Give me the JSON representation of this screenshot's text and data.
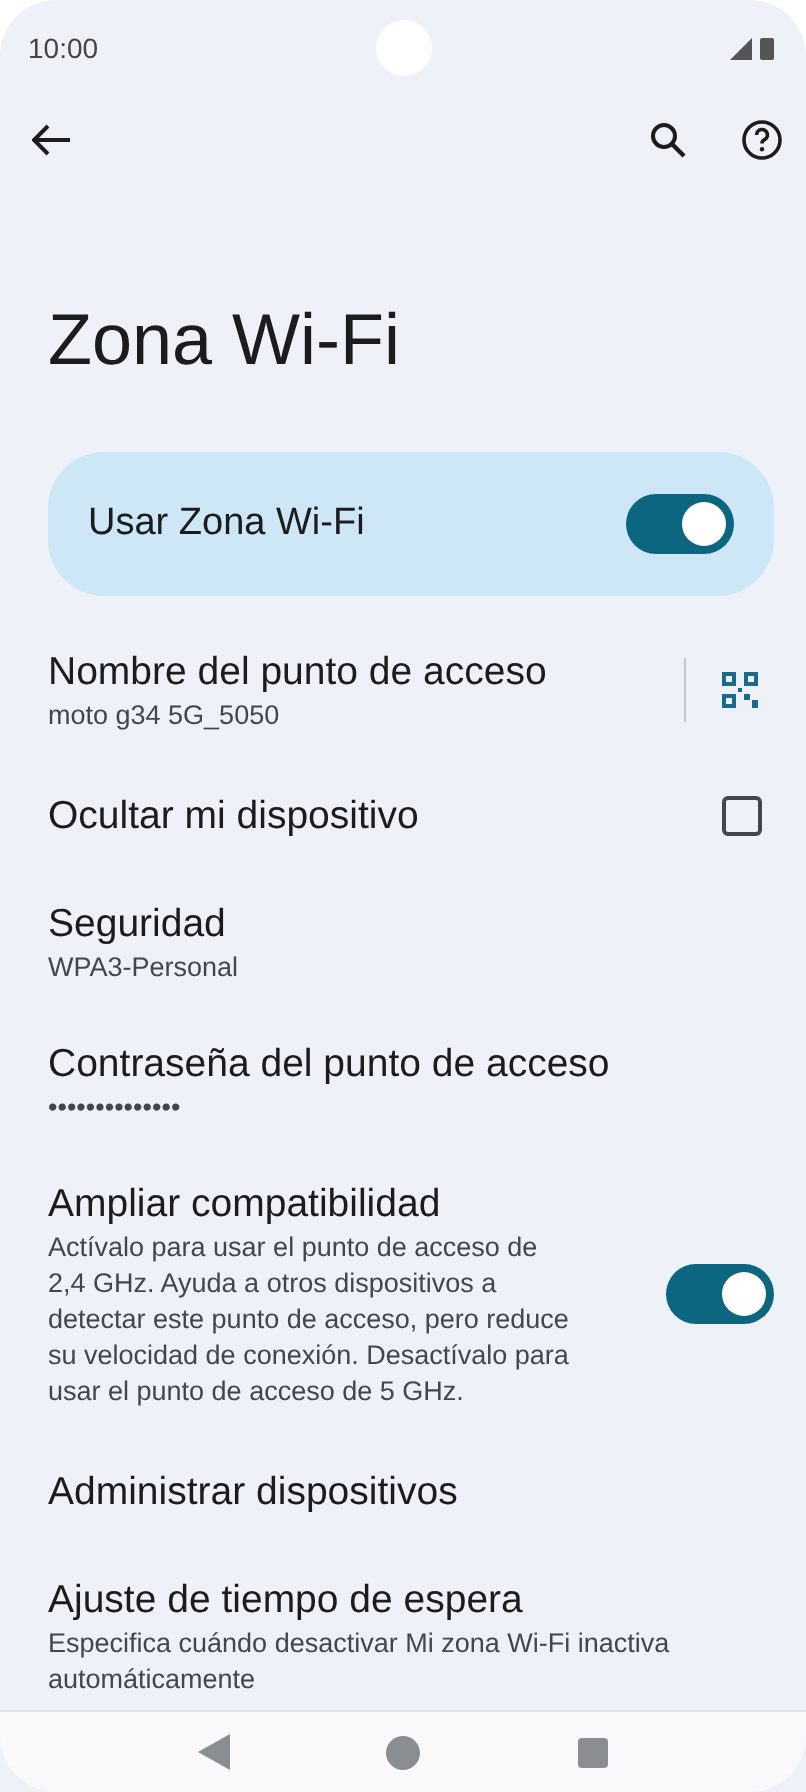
{
  "status_bar": {
    "time": "10:00"
  },
  "title": "Zona Wi-Fi",
  "main_switch": {
    "label": "Usar Zona Wi-Fi",
    "on": true
  },
  "settings": [
    {
      "kind": "qr",
      "title": "Nombre del punto de acceso",
      "summary": "moto g34 5G_5050"
    },
    {
      "kind": "checkbox",
      "title": "Ocultar mi dispositivo",
      "checked": false
    },
    {
      "kind": "text",
      "title": "Seguridad",
      "summary": "WPA3-Personal"
    },
    {
      "kind": "text",
      "title": "Contraseña del punto de acceso",
      "summary": "••••••••••••••"
    },
    {
      "kind": "switch",
      "title": "Ampliar compatibilidad",
      "summary": "Actívalo para usar el punto de acceso de 2,4 GHz. Ayuda a otros dispositivos a detectar este punto de acceso, pero reduce su velocidad de conexión. Desactívalo para usar el punto de acceso de 5 GHz.",
      "on": true
    },
    {
      "kind": "text",
      "title": "Administrar dispositivos"
    },
    {
      "kind": "text",
      "title": "Ajuste de tiempo de espera",
      "summary": "Especifica cuándo desactivar Mi zona Wi-Fi inactiva automáticamente"
    }
  ]
}
